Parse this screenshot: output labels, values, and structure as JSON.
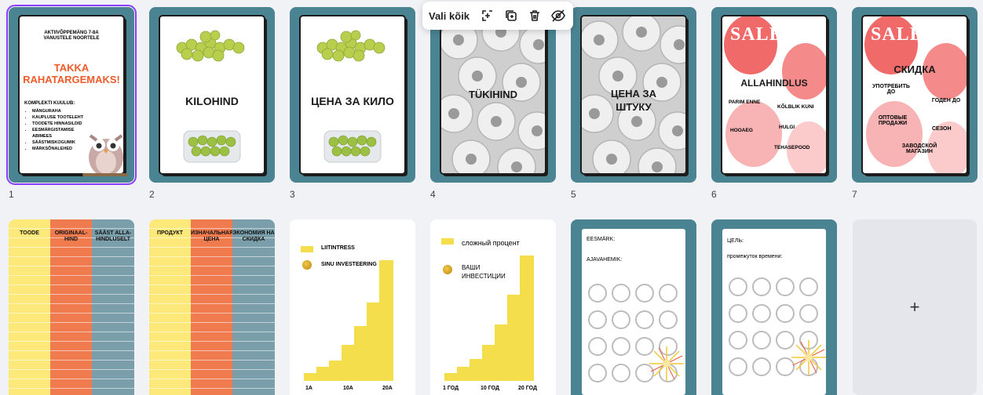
{
  "toolbar": {
    "select_all": "Vali kõik",
    "icons": [
      "add-page-icon",
      "duplicate-icon",
      "trash-icon",
      "hide-icon"
    ]
  },
  "pages": [
    {
      "num": "1",
      "top": "AKTIIVÕPPEMÄNG 7-8A VANUSTELE NOORTELE",
      "title": "TAKKA RAHATARGEMAKS!",
      "list_title": "KOMPLEKTI KUULUB:",
      "items": [
        "MÄNGURAHA",
        "KAUPLUSE TOOTELEHT",
        "TOODETE HINNASILDID",
        "EESMÄRGISTAMISE ABIMEES",
        "SÄÄSTMISKOGUMIK",
        "MÄRKSÕNALEHED"
      ]
    },
    {
      "num": "2",
      "label": "KILOHIND"
    },
    {
      "num": "3",
      "label": "ЦЕНА ЗА КИЛО"
    },
    {
      "num": "4",
      "label": "TÜKIHIND"
    },
    {
      "num": "5",
      "label": "ЦЕНА ЗА ШТУКУ"
    },
    {
      "num": "6",
      "sale": "SALE",
      "title": "ALLAHINDLUS",
      "words": [
        "PARIM ENNE",
        "KÕLBLIK KUNI",
        "HOOAEG",
        "HULGI",
        "TEHASEPOOD"
      ]
    },
    {
      "num": "7",
      "sale": "SALE",
      "title": "СКИДКА",
      "words": [
        "УПОТРЕБИТЬ ДО",
        "ГОДЕН ДО",
        "ОПТОВЫЕ ПРОДАЖИ",
        "СЕЗОН",
        "ЗАВОДСКОЙ МАГАЗИН"
      ]
    },
    {
      "headers": [
        "TOODE",
        "ORIGINAAL-HIND",
        "SÄÄST ALLA-HINDLUSELT"
      ]
    },
    {
      "headers": [
        "ПРОДУКТ",
        "ИЗНАЧАЛЬНАЯ ЦЕНА",
        "ЭКОНОМИЯ НА СКИДКА"
      ]
    },
    {
      "leg1": "LIITINTRESS",
      "leg2": "SINU INVESTEERING",
      "x": [
        "1A",
        "10A",
        "20A"
      ]
    },
    {
      "leg1": "сложный процент",
      "leg2": "ВАШИ ИНВЕСТИЦИИ",
      "x": [
        "1 ГОД",
        "10 ГОД",
        "20 ГОД"
      ]
    },
    {
      "l1": "EESMÄRK:",
      "l2": "AJAVAHEMIK:"
    },
    {
      "l1": "ЦЕЛЬ:",
      "l2": "промежуток времени:"
    }
  ],
  "add_page": "+",
  "colors": {
    "teal": "#4a8391",
    "orange": "#ef7b4f",
    "yellow": "#fce97a",
    "selection": "#8b3dff",
    "sale_red": "#f06a6a"
  }
}
